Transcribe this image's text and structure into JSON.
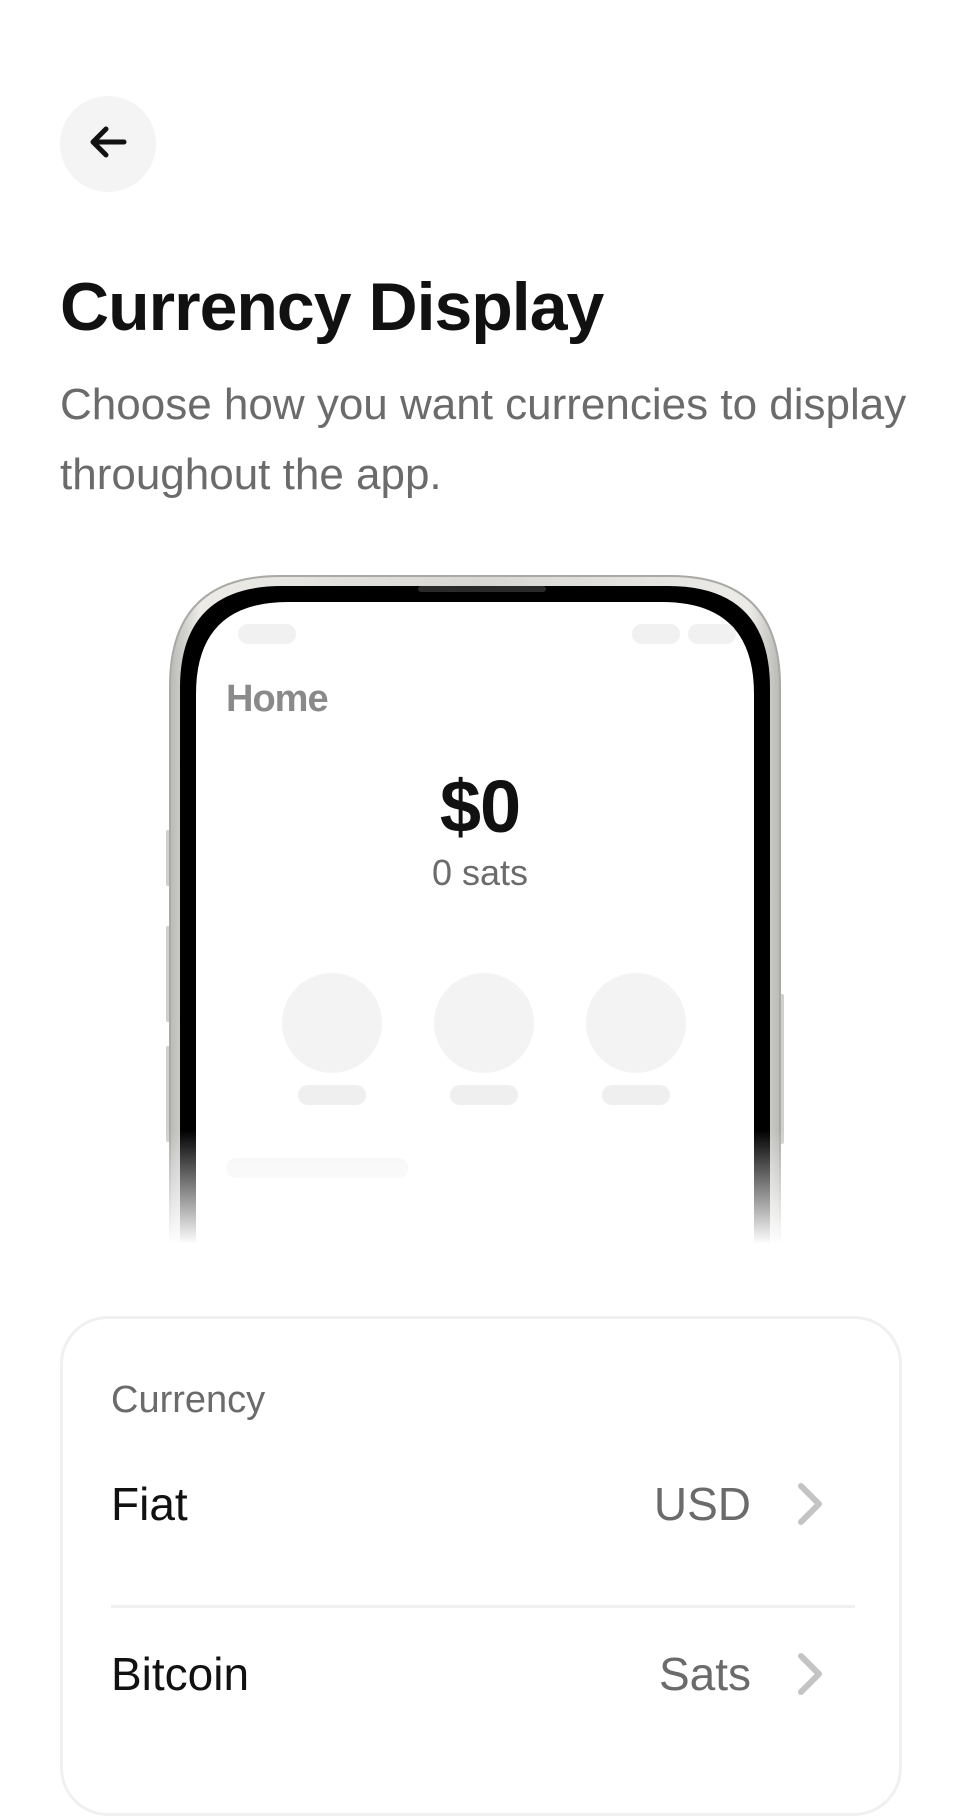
{
  "header": {
    "back_icon": "arrow-left-icon"
  },
  "page": {
    "title": "Currency Display",
    "subtitle": "Choose how you want currencies to display throughout the app."
  },
  "preview": {
    "screen_title": "Home",
    "balance": "$0",
    "sats": "0 sats"
  },
  "currency_card": {
    "section_label": "Currency",
    "rows": [
      {
        "label": "Fiat",
        "value": "USD",
        "icon": "chevron-right-icon"
      },
      {
        "label": "Bitcoin",
        "value": "Sats",
        "icon": "chevron-right-icon"
      }
    ]
  }
}
